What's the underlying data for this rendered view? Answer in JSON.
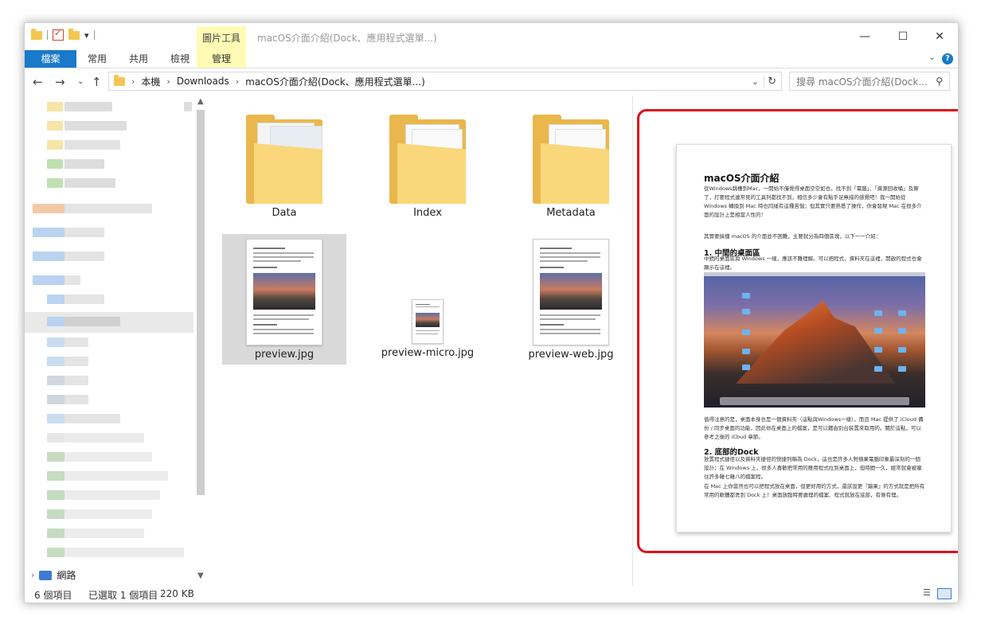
{
  "qat": {
    "dropdown_glyph": "▾"
  },
  "ribbon": {
    "context_group": "圖片工具",
    "tabs": [
      "檔案",
      "常用",
      "共用",
      "檢視",
      "管理"
    ],
    "help": "?"
  },
  "window": {
    "title": "macOS介面介紹(Dock、應用程式選單...)"
  },
  "address": {
    "crumbs": [
      "本機",
      "Downloads",
      "macOS介面介紹(Dock、應用程式選單...)"
    ]
  },
  "search": {
    "placeholder": "搜尋 macOS介面介紹(Dock..."
  },
  "nav": {
    "network_label": "網路"
  },
  "items": [
    {
      "label": "Data"
    },
    {
      "label": "Index"
    },
    {
      "label": "Metadata"
    },
    {
      "label": "preview.jpg"
    },
    {
      "label": "preview-micro.jpg"
    },
    {
      "label": "preview-web.jpg"
    }
  ],
  "preview_doc": {
    "title": "macOS介面介紹",
    "intro": "從Windows跳槽到Mac，一開始不僅覺得桌面空空如也，找不到「電腦」、「資源回收桶」及算了，打要程式連常見的工具列都找不到，相信多少會有點手足無措的感覺吧！我一開始從 Windows 轉換到 Mac 時也同樣有這種苦惱；但其實只要熟悉了操作，你會發現 Mac 在很多介面的設計上是相當人性的！",
    "intro2": "其實要搞懂 macOS 的介面並不困難，主要就分為四個區塊，以下一一介紹：",
    "s1_title": "1. 中間的桌面區",
    "s1_text": "中間的桌面區與 Windows 一樣，應該不難理解。可以把程式、資料夾在這裡，開啟的程式也會顯示在這裡。",
    "s1_after": "值得注意的是，桌面本身也是一個資料夾（這點與Windows一樣），而且 Mac 提供了 iCloud 備份 / 同步桌面的功能，因此你在桌面上的檔案，是可以藉由別台裝置來取用的。關於這點，可以參考之後的 iCbud 章節。",
    "s2_title": "2. 底部的Dock",
    "s2_text": "放置程式捷徑以及資料夾捷徑的快捷列稱為 Dock，這也是許多人對蘋果電腦印象最深刻的一個設計；在 Windows 上，很多人喜歡把常用的應用程式拉到桌面上，但時間一久，經常就會被塞住許多雜七雜八的檔案程。",
    "s2_text2": "在 Mac 上你當然也可以把程式放在桌面，但更好用的方式，還該設更『蹦果』的方式就是把所有常用的軟體都丟到 Dock 上！桌面放臨時要處理的檔案、程式就放在底部，有條有理。"
  },
  "status": {
    "count": "6 個項目",
    "selection": "已選取 1 個項目",
    "size": "220 KB"
  }
}
